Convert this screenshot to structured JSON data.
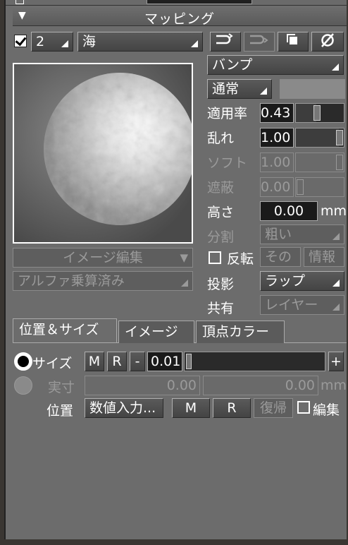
{
  "header": {
    "title": "マッピング"
  },
  "layer": {
    "number": "2",
    "material": "海"
  },
  "map_type": "バンプ",
  "blend_mode": "通常",
  "params": {
    "apply_rate": {
      "label": "適用率",
      "value": "0.43",
      "fraction": 0.43
    },
    "turbulence": {
      "label": "乱れ",
      "value": "1.00",
      "fraction": 1.0
    },
    "soft": {
      "label": "ソフト",
      "value": "1.00"
    },
    "occlusion": {
      "label": "遮蔽",
      "value": "0.00"
    },
    "height": {
      "label": "高さ",
      "value": "0.00",
      "unit": "mm"
    },
    "division": {
      "label": "分割",
      "value": "粗い"
    }
  },
  "image_edit": "イメージ編集",
  "alpha_premul": "アルファ乗算済み",
  "flip": {
    "label": "反転",
    "other": "その",
    "info": "情報"
  },
  "projection": {
    "label": "投影",
    "value": "ラップ"
  },
  "share": {
    "label": "共有",
    "value": "レイヤー"
  },
  "tabs": [
    "位置＆サイズ",
    "イメージ",
    "頂点カラー"
  ],
  "size_row": {
    "label": "サイズ",
    "m": "M",
    "r": "R",
    "minus": "-",
    "value": "0.01",
    "plus": "+"
  },
  "actual_row": {
    "label": "実寸",
    "v1": "0.00",
    "v2": "0.00",
    "unit": "mm"
  },
  "position_row": {
    "label": "位置",
    "numeric": "数値入力...",
    "m": "M",
    "r": "R",
    "restore": "復帰",
    "edit": "編集"
  },
  "colors": {
    "panel": "#6c6c6c",
    "field": "#1a1a1a",
    "disabled_text": "#9a9a9a"
  }
}
